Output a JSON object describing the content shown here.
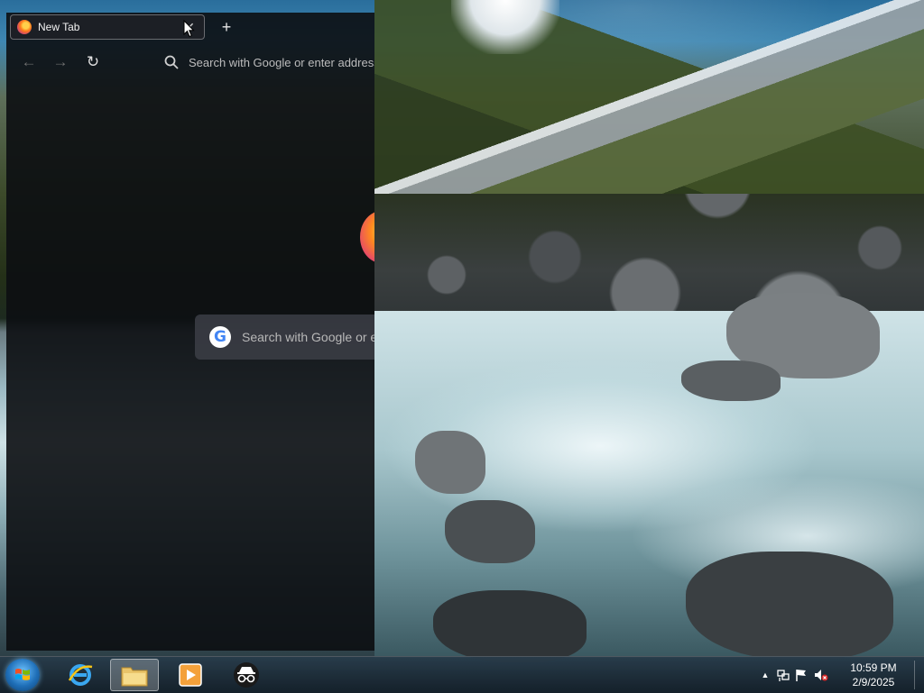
{
  "browser": {
    "tab": {
      "title": "New Tab",
      "close_symbol": "✕"
    },
    "new_tab_symbol": "+",
    "nav": {
      "back": "←",
      "forward": "→",
      "reload": "↻"
    },
    "urlbar": {
      "placeholder": "Search with Google or enter address"
    },
    "newtab_page": {
      "search_placeholder": "Search with Google or enter address",
      "engine_letter": "G"
    }
  },
  "taskbar": {
    "items": [
      {
        "name": "internet-explorer",
        "icon": "ie-icon",
        "active": false
      },
      {
        "name": "file-explorer",
        "icon": "folder-icon",
        "active": true
      },
      {
        "name": "media-player",
        "icon": "play-icon",
        "active": false
      },
      {
        "name": "incognito-app",
        "icon": "incognito-icon",
        "active": false
      }
    ],
    "tray": {
      "expand_symbol": "▲",
      "icons": [
        "network-icon",
        "flag-icon",
        "volume-muted-icon"
      ]
    },
    "clock": {
      "time": "10:59 PM",
      "date": "2/9/2025"
    }
  },
  "colors": {
    "browser_bg": "#0c0e12",
    "tab_border": "#8a8a8a",
    "taskbar_bg": "#1d2f3c"
  }
}
